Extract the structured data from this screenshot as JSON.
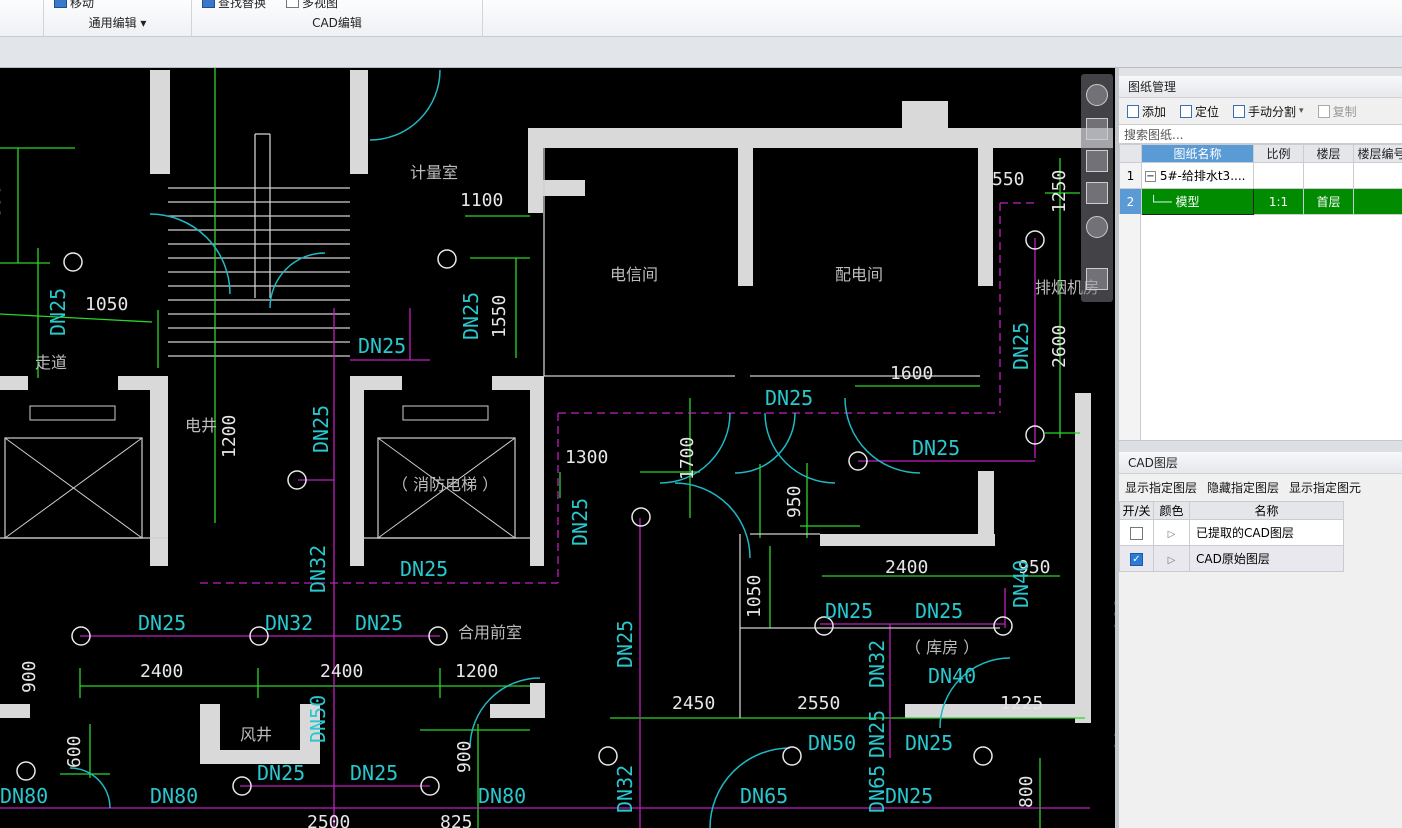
{
  "ribbon": {
    "groups": [
      {
        "label": "通用编辑",
        "buttons": [
          {
            "label": "移动"
          }
        ]
      },
      {
        "label": "CAD编辑",
        "buttons": [
          {
            "label": "查找替换"
          },
          {
            "label": "多视图"
          }
        ]
      }
    ]
  },
  "drawing": {
    "rooms": [
      "计量室",
      "电信间",
      "配电间",
      "排烟机房",
      "走道",
      "电井",
      "（ 消防电梯 ）",
      "合用前室",
      "（ 库房 ）",
      "风井"
    ],
    "dims": [
      "1100",
      "550",
      "1250",
      "1550",
      "1050",
      "1550",
      "2600",
      "1600",
      "1200",
      "1300",
      "1700",
      "950",
      "2400",
      "950",
      "1050",
      "2400",
      "2400",
      "1200",
      "900",
      "2450",
      "2550",
      "1225",
      "600",
      "900",
      "800",
      "2500",
      "825",
      "1550",
      "2400"
    ],
    "pipes": [
      "DN25",
      "DN25",
      "DN25",
      "DN25",
      "DN25",
      "DN25",
      "DN25",
      "DN25",
      "DN25",
      "DN32",
      "DN25",
      "DN25",
      "DN32",
      "DN25",
      "DN40",
      "DN25",
      "DN25",
      "DN32",
      "DN40",
      "DN25",
      "DN50",
      "DN50",
      "DN25",
      "DN25",
      "DN25",
      "DN80",
      "DN80",
      "DN80",
      "DN32",
      "DN65",
      "DN65",
      "DN25",
      "DN25"
    ]
  },
  "panel": {
    "title": "图纸管理",
    "toolbar": {
      "add": "添加",
      "locate": "定位",
      "split": "手动分割",
      "copy": "复制"
    },
    "search_placeholder": "搜索图纸...",
    "columns": [
      "图纸名称",
      "比例",
      "楼层",
      "楼层编号"
    ],
    "rows": [
      {
        "num": "1",
        "name": "5#-给排水t3....",
        "scale": "",
        "floor": "",
        "code": ""
      },
      {
        "num": "2",
        "name": "模型",
        "scale": "1:1",
        "floor": "首层",
        "code": ""
      }
    ]
  },
  "layers": {
    "title": "CAD图层",
    "actions": [
      "显示指定图层",
      "隐藏指定图层",
      "显示指定图元"
    ],
    "columns": [
      "开/关",
      "颜色",
      "名称"
    ],
    "rows": [
      {
        "checked": false,
        "name": "已提取的CAD图层"
      },
      {
        "checked": true,
        "name": "CAD原始图层"
      }
    ]
  },
  "colors": {
    "wall": "#d9d9d9",
    "dim": "#2bd62b",
    "pipe_label": "#29c8cf",
    "pipe": "#c020c0",
    "door": "#1fb8c4",
    "selected_row": "#008b00"
  }
}
